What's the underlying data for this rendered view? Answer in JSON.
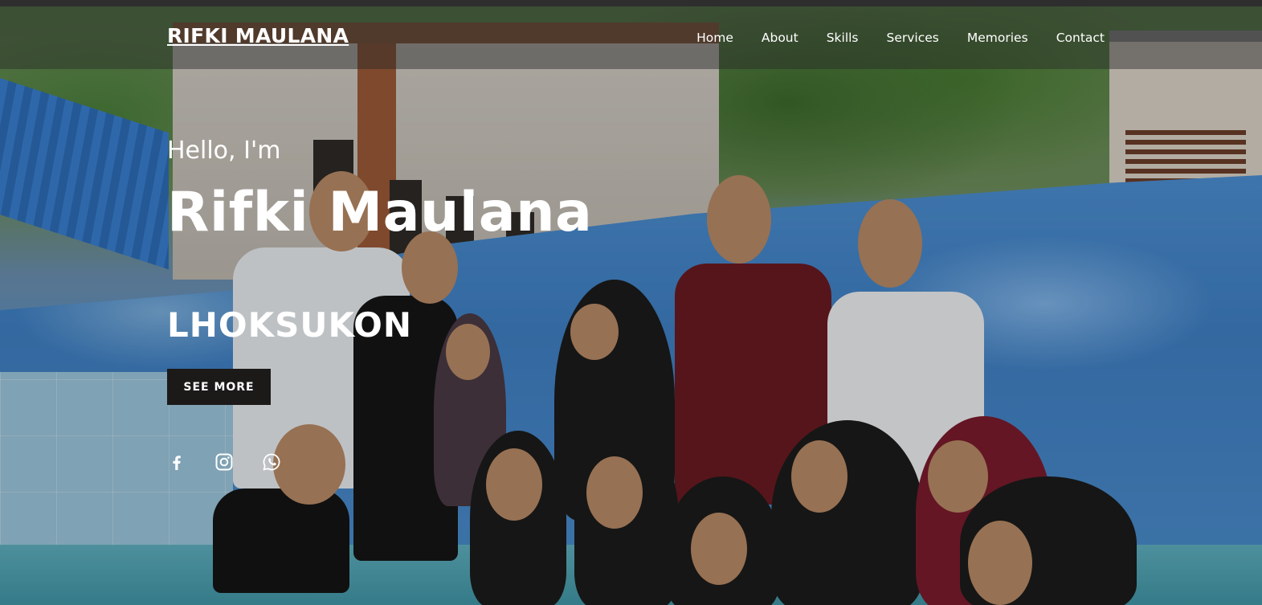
{
  "navbar": {
    "brand": "RIFKI MAULANA",
    "items": [
      {
        "label": "Home"
      },
      {
        "label": "About"
      },
      {
        "label": "Skills"
      },
      {
        "label": "Services"
      },
      {
        "label": "Memories"
      },
      {
        "label": "Contact"
      }
    ]
  },
  "hero": {
    "greeting": "Hello, I'm",
    "name": "Rifki Maulana",
    "place": "LHOKSUKON",
    "cta_label": "SEE MORE"
  },
  "socials": [
    {
      "icon": "facebook-icon"
    },
    {
      "icon": "instagram-icon"
    },
    {
      "icon": "whatsapp-icon"
    }
  ],
  "colors": {
    "text": "#ffffff",
    "button_bg": "#1c1a19",
    "navbar_bg": "rgba(40,40,40,0.45)"
  }
}
